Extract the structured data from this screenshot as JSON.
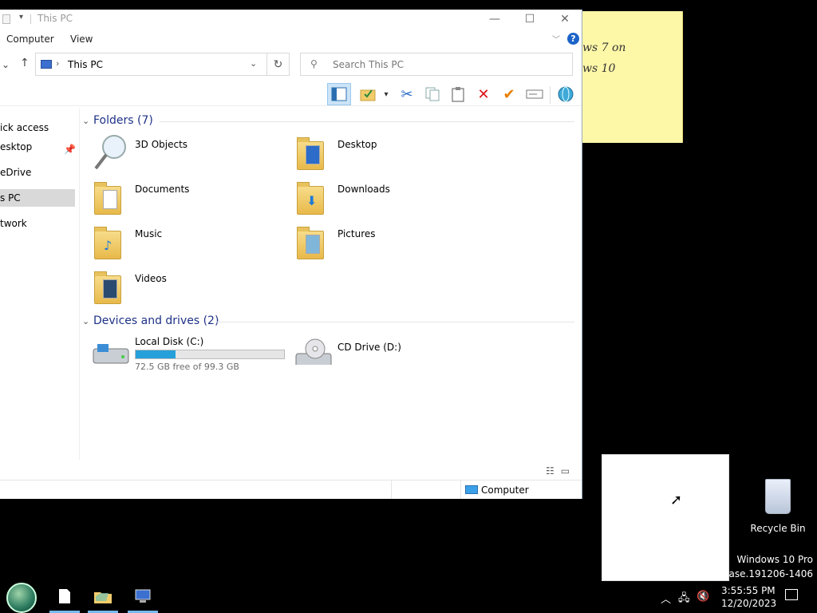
{
  "window": {
    "title": "This PC",
    "min": "—",
    "max": "☐",
    "close": "✕",
    "ribbon_tabs": [
      "Computer",
      "View"
    ],
    "help": "?"
  },
  "address": {
    "path": "This PC",
    "search_placeholder": "Search This PC"
  },
  "toolbar": {
    "items": [
      "view-pane",
      "folder-options",
      "cut",
      "copy",
      "paste",
      "delete",
      "properties",
      "rename",
      "globe"
    ]
  },
  "nav": {
    "items": [
      "ick access",
      "esktop",
      "eDrive",
      "s PC",
      "twork"
    ],
    "selected": "s PC"
  },
  "folders": {
    "header": "Folders (7)",
    "items": [
      "3D Objects",
      "Desktop",
      "Documents",
      "Downloads",
      "Music",
      "Pictures",
      "Videos"
    ]
  },
  "devices": {
    "header": "Devices and drives (2)",
    "local": {
      "name": "Local Disk (C:)",
      "free": "72.5 GB free of 99.3 GB",
      "used_fraction": 0.27
    },
    "cd": {
      "name": "CD Drive (D:)"
    }
  },
  "status": {
    "location": "Computer"
  },
  "sticky": {
    "lines": [
      "ws 7 on",
      "ws 10"
    ]
  },
  "desktop": {
    "recycle_bin": "Recycle Bin",
    "watermark_line1": "Windows 10 Pro",
    "watermark_line2": "release.191206-1406"
  },
  "taskbar": {
    "time": "3:55:55 PM",
    "date": "12/20/2023"
  },
  "colors": {
    "accent": "#26a0da",
    "header_blue": "#1e3287",
    "sticky": "#fdf7a8"
  }
}
